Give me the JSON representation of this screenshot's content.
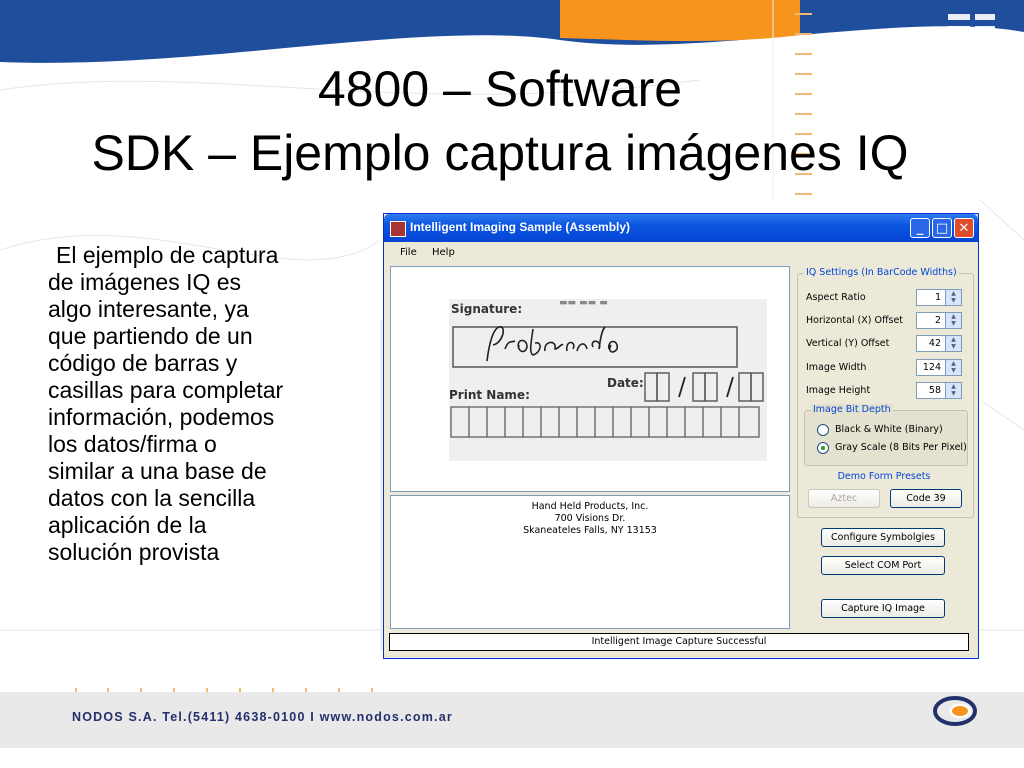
{
  "slide": {
    "title_line1": "4800 – Software",
    "title_line2": "SDK – Ejemplo captura imágenes IQ",
    "body_lines": [
      "El ejemplo de captura",
      "de imágenes IQ es",
      "algo interesante, ya",
      "que partiendo de un",
      "código de barras y",
      "casillas para completar",
      "información, podemos",
      "los datos/firma o",
      "similar a una base de",
      "datos con la sencilla",
      "aplicación de la",
      "solución provista"
    ],
    "footer": "NODOS S.A.  Tel.(5411) 4638-0100 I www.nodos.com.ar",
    "colors": {
      "banner_blue": "#1f4e9c",
      "accent_orange": "#f7941d",
      "footer_text": "#24306b"
    }
  },
  "window": {
    "title": "Intelligent Imaging Sample (Assembly)",
    "menu": [
      "File",
      "Help"
    ],
    "captured_image": {
      "signature_label": "Signature:",
      "date_label": "Date:",
      "print_name_label": "Print Name:",
      "handwriting": "Probando"
    },
    "address": [
      "Hand Held Products, Inc.",
      "700 Visions Dr.",
      "Skaneateles Falls, NY 13153"
    ],
    "settings": {
      "group_label": "IQ Settings (In BarCode Widths)",
      "fields": [
        {
          "label": "Aspect Ratio",
          "value": "1"
        },
        {
          "label": "Horizontal (X) Offset",
          "value": "2"
        },
        {
          "label": "Vertical (Y) Offset",
          "value": "42"
        },
        {
          "label": "Image Width",
          "value": "124"
        },
        {
          "label": "Image Height",
          "value": "58"
        }
      ],
      "bit_depth": {
        "label": "Image Bit Depth",
        "options": [
          "Black & White (Binary)",
          "Gray Scale (8 Bits Per Pixel)"
        ],
        "selected": "Gray Scale (8 Bits Per Pixel)"
      },
      "presets": {
        "label": "Demo Form Presets",
        "buttons": [
          "Aztec",
          "Code 39"
        ]
      }
    },
    "buttons": {
      "configure": "Configure Symbolgies",
      "select_port": "Select COM Port",
      "capture": "Capture IQ Image"
    },
    "status": "Intelligent Image Capture Successful"
  }
}
